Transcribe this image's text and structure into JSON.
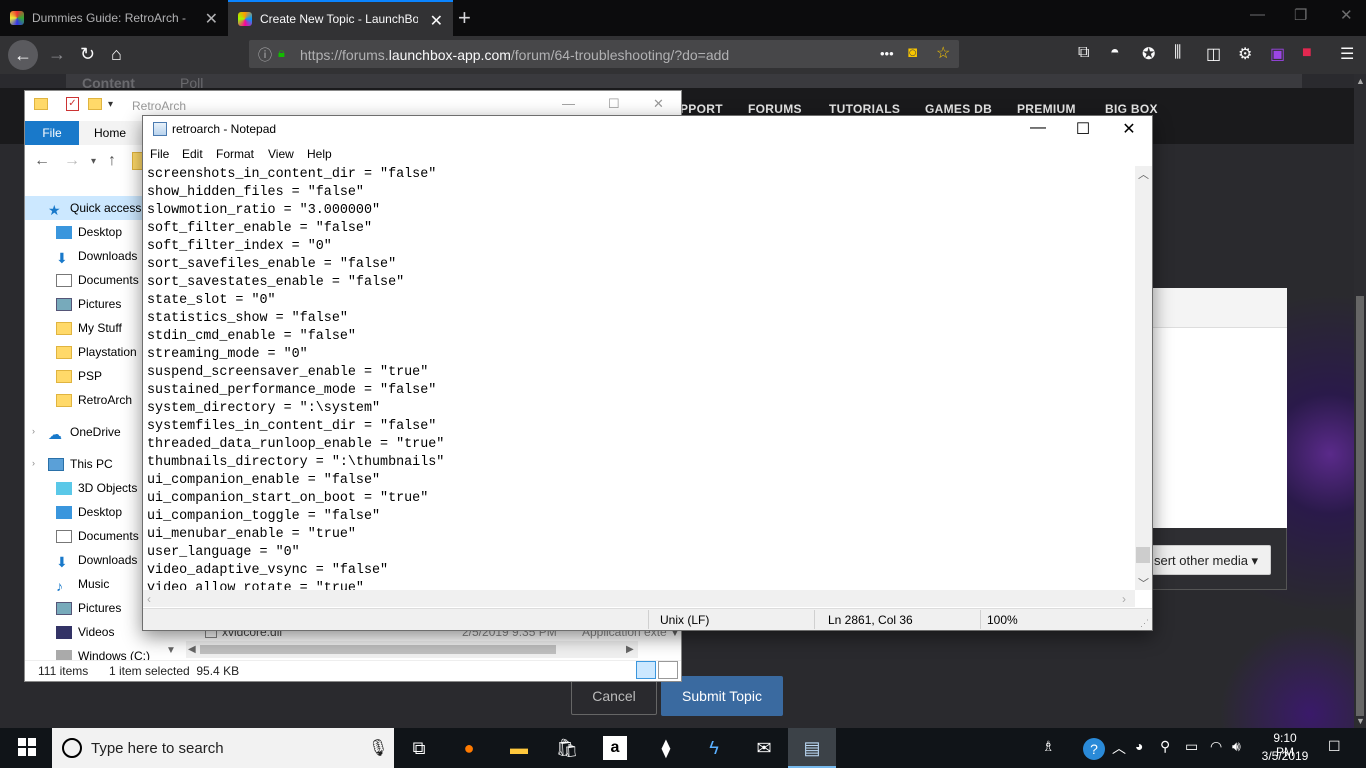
{
  "browser": {
    "tabs": [
      {
        "title": "Dummies Guide: RetroArch - E"
      },
      {
        "title": "Create New Topic - LaunchBox"
      }
    ],
    "url_prefix": "https://forums.",
    "url_domain": "launchbox-app.com",
    "url_path": "/forum/64-troubleshooting/?do=add",
    "menu_dots": "•••"
  },
  "site": {
    "top_tabs": [
      "Content",
      "Poll"
    ],
    "nav": [
      "PPORT",
      "FORUMS",
      "TUTORIALS",
      "GAMES DB",
      "PREMIUM",
      "BIG BOX"
    ],
    "insert_media": "sert other media ▾",
    "cancel": "Cancel",
    "submit": "Submit Topic"
  },
  "explorer": {
    "title": "RetroArch",
    "ribbon": {
      "file": "File",
      "home": "Home"
    },
    "tree": [
      {
        "label": "Quick access",
        "icon": "star-icon"
      },
      {
        "label": "Desktop",
        "icon": "desktop-icon"
      },
      {
        "label": "Downloads",
        "icon": "download-arrow-icon"
      },
      {
        "label": "Documents",
        "icon": "document-icon"
      },
      {
        "label": "Pictures",
        "icon": "pictures-icon"
      },
      {
        "label": "My Stuff",
        "icon": "folder-icon"
      },
      {
        "label": "Playstation",
        "icon": "folder-icon"
      },
      {
        "label": "PSP",
        "icon": "folder-icon"
      },
      {
        "label": "RetroArch",
        "icon": "folder-icon"
      },
      {
        "label": "OneDrive",
        "icon": "cloud-icon"
      },
      {
        "label": "This PC",
        "icon": "computer-icon"
      },
      {
        "label": "3D Objects",
        "icon": "cube-icon"
      },
      {
        "label": "Desktop",
        "icon": "desktop-icon"
      },
      {
        "label": "Documents",
        "icon": "document-icon"
      },
      {
        "label": "Downloads",
        "icon": "download-arrow-icon"
      },
      {
        "label": "Music",
        "icon": "music-icon"
      },
      {
        "label": "Pictures",
        "icon": "pictures-icon"
      },
      {
        "label": "Videos",
        "icon": "video-icon"
      },
      {
        "label": "Windows (C:)",
        "icon": "drive-icon"
      }
    ],
    "bg_file": {
      "name": "xvidcore.dll",
      "date": "2/5/2019 9:35 PM",
      "type": "Application exte"
    },
    "status": {
      "items": "111 items",
      "selected": "1 item selected  95.4 KB"
    }
  },
  "notepad": {
    "title": "retroarch - Notepad",
    "menu": [
      "File",
      "Edit",
      "Format",
      "View",
      "Help"
    ],
    "lines": [
      "screenshots_in_content_dir = \"false\"",
      "show_hidden_files = \"false\"",
      "slowmotion_ratio = \"3.000000\"",
      "soft_filter_enable = \"false\"",
      "soft_filter_index = \"0\"",
      "sort_savefiles_enable = \"false\"",
      "sort_savestates_enable = \"false\"",
      "state_slot = \"0\"",
      "statistics_show = \"false\"",
      "stdin_cmd_enable = \"false\"",
      "streaming_mode = \"0\"",
      "suspend_screensaver_enable = \"true\"",
      "sustained_performance_mode = \"false\"",
      "system_directory = \":\\system\"",
      "systemfiles_in_content_dir = \"false\"",
      "threaded_data_runloop_enable = \"true\"",
      "thumbnails_directory = \":\\thumbnails\"",
      "ui_companion_enable = \"false\"",
      "ui_companion_start_on_boot = \"true\"",
      "ui_companion_toggle = \"false\"",
      "ui_menubar_enable = \"true\"",
      "user_language = \"0\"",
      "video_adaptive_vsync = \"false\"",
      "video_allow_rotate = \"true\""
    ],
    "status": {
      "eol": "Unix (LF)",
      "position": "Ln 2861, Col 36",
      "zoom": "100%"
    }
  },
  "taskbar": {
    "search_placeholder": "Type here to search",
    "time": "9:10 PM",
    "date": "3/5/2019"
  },
  "colors": {
    "accent": "#0a84ff",
    "explorer_file_tab": "#1979ca",
    "submit_button": "#3a6aa0"
  }
}
